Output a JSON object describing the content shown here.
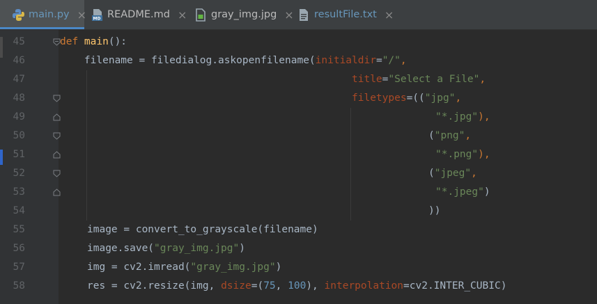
{
  "tabs": [
    {
      "label": "main.py",
      "icon": "python-file-icon",
      "active": true,
      "close": "×"
    },
    {
      "label": "README.md",
      "icon": "markdown-file-icon",
      "active": false,
      "close": "×"
    },
    {
      "label": "gray_img.jpg",
      "icon": "image-file-icon",
      "active": false,
      "close": "×"
    },
    {
      "label": "resultFile.txt",
      "icon": "text-file-icon",
      "active": false,
      "close": "×"
    }
  ],
  "line_numbers": [
    "45",
    "46",
    "47",
    "48",
    "49",
    "50",
    "51",
    "52",
    "53",
    "54",
    "55",
    "56",
    "57",
    "58"
  ],
  "code": {
    "l45": {
      "kw": "def ",
      "fn": "main",
      "rest": "():"
    },
    "l46": {
      "indent": "    ",
      "a": "filename = filedialog.askopenfilename(",
      "p": "initialdir",
      "eq": "=",
      "s": "\"/\"",
      "end": ","
    },
    "l47": {
      "p": "title",
      "eq": "=",
      "s": "\"Select a File\"",
      "end": ","
    },
    "l48": {
      "p": "filetypes",
      "eq": "=((",
      "s": "\"jpg\"",
      "end": ","
    },
    "l49": {
      "s": "\"*.jpg\"",
      "end": "),"
    },
    "l50": {
      "a": "(",
      "s": "\"png\"",
      "end": ","
    },
    "l51": {
      "s": "\"*.png\"",
      "end": "),"
    },
    "l52": {
      "a": "(",
      "s": "\"jpeg\"",
      "end": ","
    },
    "l53": {
      "s": "\"*.jpeg\"",
      "end": ")"
    },
    "l54": {
      "a": "))"
    },
    "l55": {
      "a": "image = convert_to_grayscale(filename)"
    },
    "l56": {
      "a": "image.save(",
      "s": "\"gray_img.jpg\"",
      "end": ")"
    },
    "l57": {
      "a": "img = cv2.imread(",
      "s": "\"gray_img.jpg\"",
      "end": ")"
    },
    "l58": {
      "a": "res = cv2.resize(img, ",
      "p1": "dsize",
      "b": "=(",
      "n1": "75",
      "c": ", ",
      "n2": "100",
      "d": "), ",
      "p2": "interpolation",
      "e": "=cv2.INTER_CUBIC)"
    }
  },
  "colors": {
    "background": "#2b2b2b",
    "gutter": "#313335",
    "tabbar": "#3c3f41",
    "active_tab": "#4e5254",
    "active_underline": "#4a88c7",
    "keyword": "#cc7832",
    "function": "#ffc66d",
    "string": "#6a8759",
    "param": "#aa4926",
    "number": "#6897bb",
    "text": "#a9b7c6"
  }
}
